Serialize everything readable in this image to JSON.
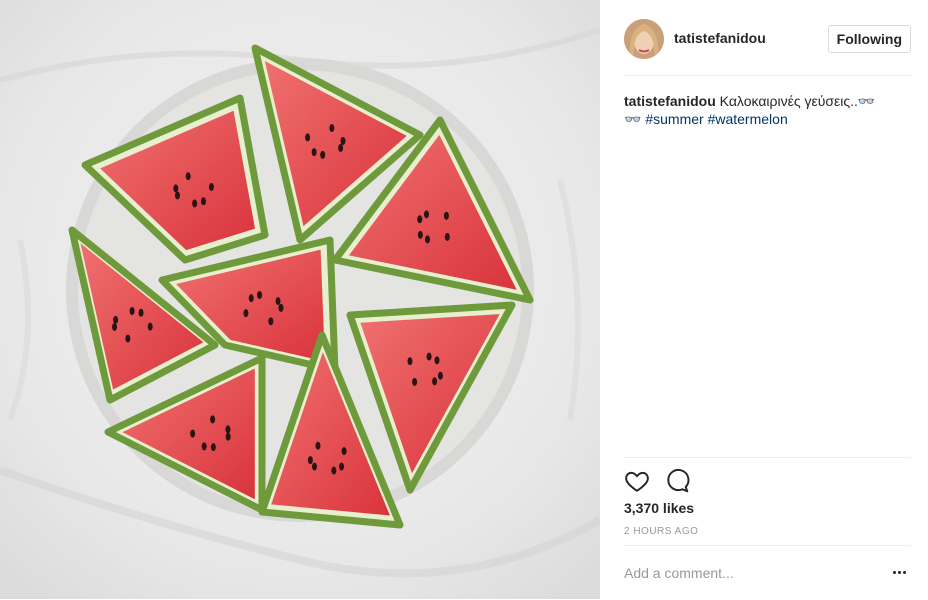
{
  "post": {
    "image_alt": "watermelon slices on a plate",
    "author": {
      "username": "tatistefanidou"
    },
    "follow_label": "Following",
    "caption": {
      "username": "tatistefanidou",
      "text": " Καλοκαιρινές γεύσεις..",
      "emoji_line1": "👓",
      "emoji_line2": "👓",
      "hashtags": [
        "#summer",
        "#watermelon"
      ]
    },
    "likes": "3,370 likes",
    "time": "2 HOURS AGO",
    "comment_placeholder": "Add a comment..."
  },
  "colors": {
    "tag_link": "#003569",
    "border": "#efefef",
    "muted": "#999999",
    "melon_red": "#e8474c",
    "rind_green": "#6f9a3c"
  },
  "icons": [
    "heart-icon",
    "comment-icon",
    "more-options-icon"
  ]
}
